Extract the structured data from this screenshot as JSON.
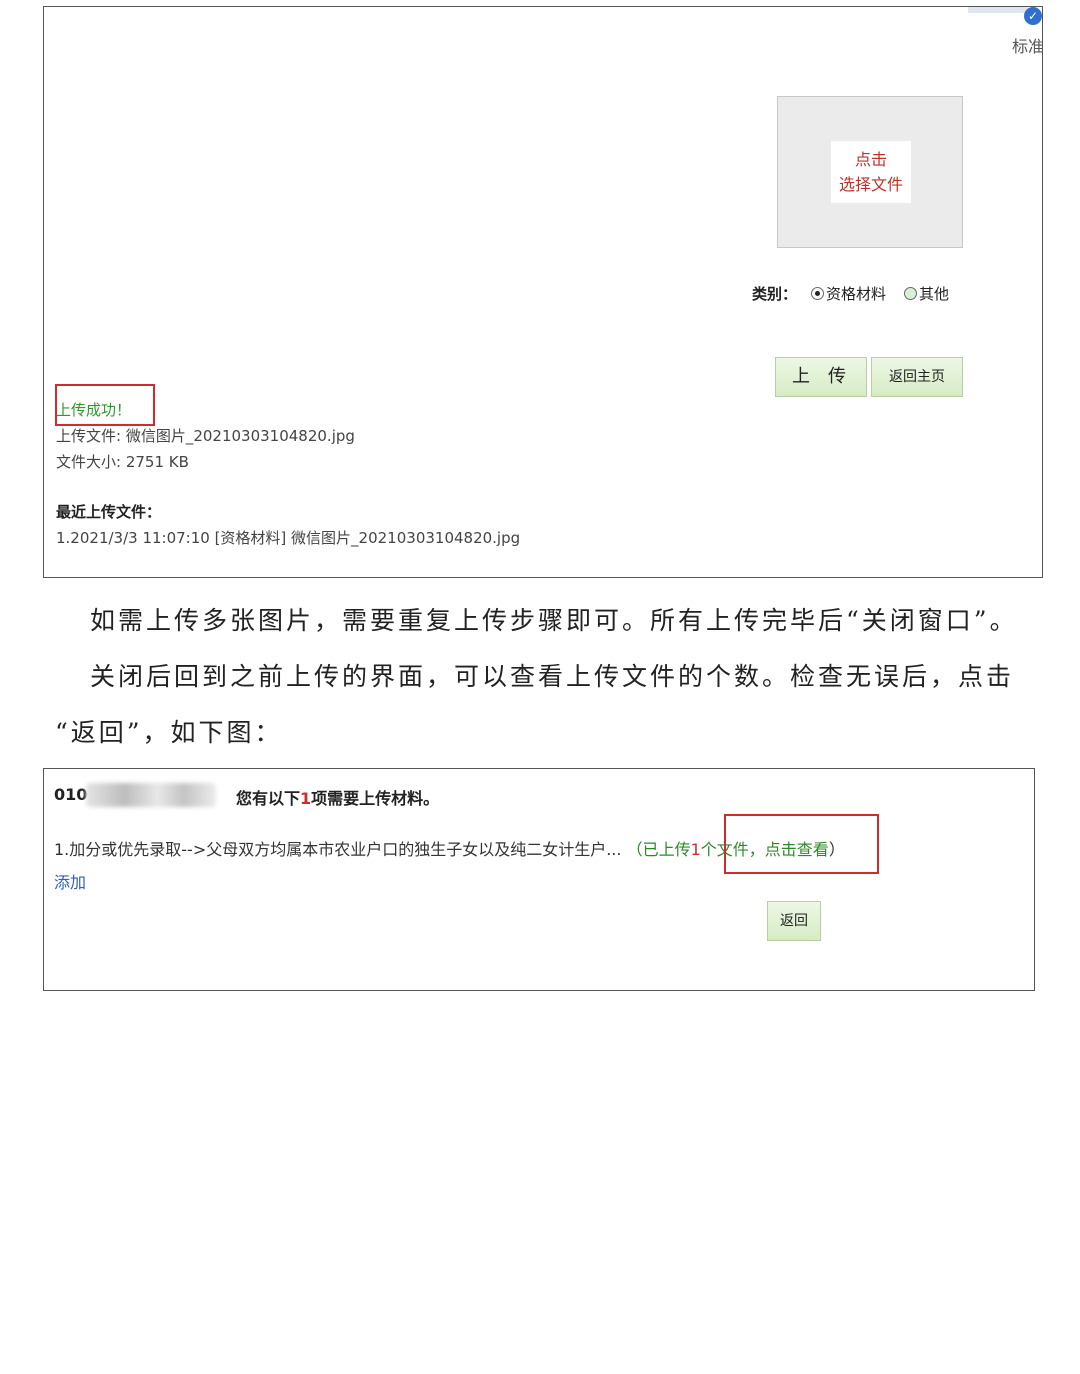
{
  "upload_window": {
    "corner_label": "标准",
    "file_picker": {
      "line1": "点击",
      "line2": "选择文件"
    },
    "category": {
      "label": "类别：",
      "options": [
        "资格材料",
        "其他"
      ],
      "selected": "资格材料"
    },
    "upload_button": "上传",
    "home_button": "返回主页",
    "success_message": "上传成功！",
    "uploaded_file": "上传文件: 微信图片_20210303104820.jpg",
    "file_size": "文件大小: 2751 KB",
    "recent_title": "最近上传文件：",
    "recent_item": "1.2021/3/3 11:07:10 [资格材料] 微信图片_20210303104820.jpg"
  },
  "instructions": {
    "line1": "如需上传多张图片，需要重复上传步骤即可。所有上传完毕后“关闭窗口”。",
    "line2": "关闭后回到之前上传的界面，可以查看上传文件的个数。检查无误后，点击",
    "line3": "“返回”，如下图："
  },
  "material_window": {
    "id_prefix": "010",
    "notice_before": "您有以下",
    "notice_count": "1",
    "notice_after": "项需要上传材料。",
    "item_text": "1.加分或优先录取-->父母双方均属本市农业户口的独生子女以及纯二女计生户...",
    "status_open": "（已上传",
    "status_count": "1",
    "status_mid": "个文件，",
    "view_link": "点击查看",
    "status_close": "）",
    "add_link": "添加",
    "back_button": "返回"
  }
}
